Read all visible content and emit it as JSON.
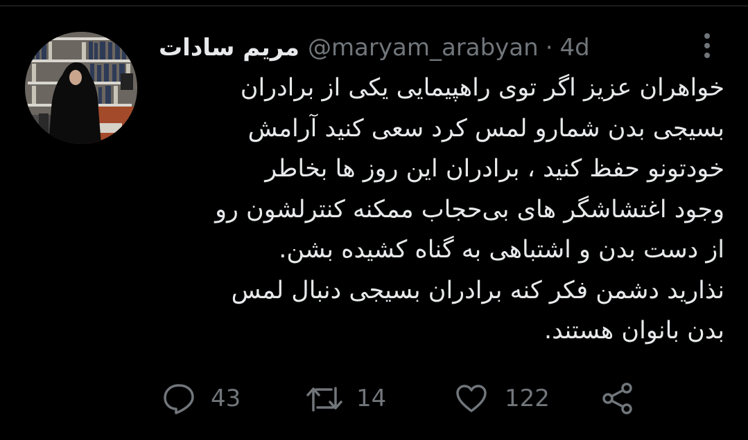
{
  "tweet": {
    "display_name": "مریم سادات",
    "handle": "@maryam_arabyan",
    "separator": "·",
    "time": "4d",
    "text_lines": [
      "خواهران عزیز اگر توی راهپیمایی یکی از برادران",
      "بسیجی بدن شمارو لمس کرد سعی کنید آرامش",
      "خودتونو حفظ کنید ، برادران این روز ها بخاطر",
      "وجود اغتشاشگر های بی‌حجاب ممکنه کنترلشون رو",
      "از دست بدن و اشتباهی به گناه کشیده بشن.",
      "نذارید دشمن فکر کنه برادران بسیجی دنبال لمس",
      "بدن بانوان هستند."
    ]
  },
  "actions": {
    "reply": {
      "icon": "reply-icon",
      "count": "43"
    },
    "retweet": {
      "icon": "retweet-icon",
      "count": "14"
    },
    "like": {
      "icon": "heart-icon",
      "count": "122"
    },
    "share": {
      "icon": "share-icon"
    }
  },
  "colors": {
    "background": "#000000",
    "text_primary": "#e7e9ea",
    "text_secondary": "#71767b"
  }
}
